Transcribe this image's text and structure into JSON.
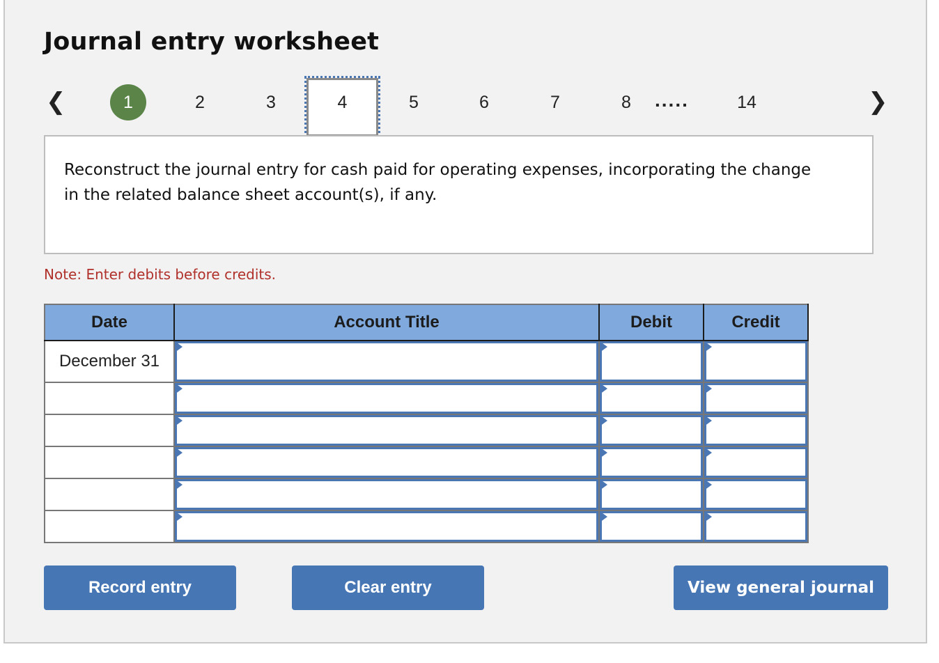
{
  "title": "Journal entry worksheet",
  "nav": {
    "prev_icon": "chevron-left-icon",
    "next_icon": "chevron-right-icon",
    "pages": [
      {
        "label": "1",
        "state": "completed"
      },
      {
        "label": "2",
        "state": "default"
      },
      {
        "label": "3",
        "state": "default"
      },
      {
        "label": "4",
        "state": "current"
      },
      {
        "label": "5",
        "state": "default"
      },
      {
        "label": "6",
        "state": "default"
      },
      {
        "label": "7",
        "state": "default"
      },
      {
        "label": "8",
        "state": "default"
      },
      {
        "label": "14",
        "state": "default"
      }
    ],
    "ellipsis": ".....",
    "completed_color": "#5a8448",
    "current_outline_color": "#4a77b4"
  },
  "prompt": "Reconstruct the journal entry for cash paid for operating expenses, incorporating the change in the related balance sheet account(s), if any.",
  "note": "Note: Enter debits before credits.",
  "note_color": "#b0302a",
  "table": {
    "header_color": "#80aadd",
    "columns": [
      "Date",
      "Account Title",
      "Debit",
      "Credit"
    ],
    "rows": [
      {
        "date": "December 31",
        "account": "",
        "debit": "",
        "credit": ""
      },
      {
        "date": "",
        "account": "",
        "debit": "",
        "credit": ""
      },
      {
        "date": "",
        "account": "",
        "debit": "",
        "credit": ""
      },
      {
        "date": "",
        "account": "",
        "debit": "",
        "credit": ""
      },
      {
        "date": "",
        "account": "",
        "debit": "",
        "credit": ""
      },
      {
        "date": "",
        "account": "",
        "debit": "",
        "credit": ""
      }
    ]
  },
  "buttons": {
    "record": "Record entry",
    "clear": "Clear entry",
    "view": "View general journal",
    "color": "#4776b4"
  }
}
